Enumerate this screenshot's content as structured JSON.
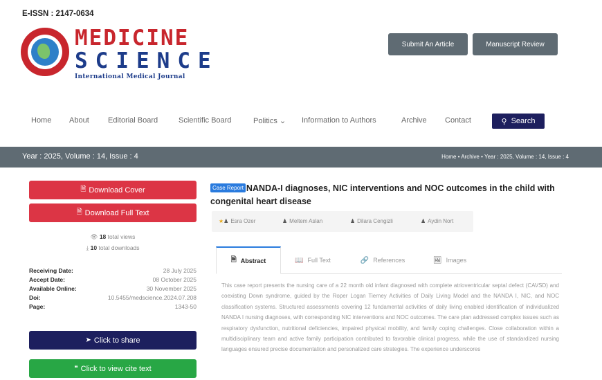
{
  "header": {
    "issn": "E-ISSN : 2147-0634",
    "logo_line1": "MEDICINE",
    "logo_line2": "SCIENCE",
    "logo_line3": "International Medical Journal",
    "submit_label": "Submit An Article",
    "review_label": "Manuscript Review"
  },
  "nav": {
    "items": [
      "Home",
      "About",
      "Editorial Board",
      "Scientific Board",
      "Politics ⌄",
      "Information to Authors",
      "Archive",
      "Contact"
    ],
    "search_label": "Search"
  },
  "issue_bar": {
    "issue": "Year : 2025, Volume : 14, Issue : 4",
    "breadcrumb": "Home • Archive • Year : 2025, Volume : 14, Issue : 4"
  },
  "sidebar": {
    "download_cover": "Download Cover",
    "download_full_text": "Download Full Text",
    "views_count": "18",
    "views_label": "total views",
    "downloads_count": "10",
    "downloads_label": "total downloads",
    "meta": [
      {
        "key": "Receiving Date:",
        "value": "28 July 2025"
      },
      {
        "key": "Accept Date:",
        "value": "08 October 2025"
      },
      {
        "key": "Available Online:",
        "value": "30 November 2025"
      },
      {
        "key": "Doi:",
        "value": "10.5455/medscience.2024.07.208"
      },
      {
        "key": "Page:",
        "value": "1343-50"
      }
    ],
    "share_label": "Click to share",
    "cite_label": "Click to view cite text"
  },
  "article": {
    "badge": "Case Report",
    "title": "NANDA-I diagnoses, NIC interventions and NOC outcomes in the child with congenital heart disease",
    "authors": [
      "Esra Ozer",
      "Meltem Aslan",
      "Dilara Cengizli",
      "Aydin Nort"
    ],
    "tabs": [
      "Abstract",
      "Full Text",
      "References",
      "Images"
    ],
    "abstract": "This case report presents the nursing care of a 22 month old infant diagnosed with complete atrioventricular septal defect (CAVSD) and coexisting Down syndrome, guided by the Roper Logan Tierney Activities of Daily Living Model and the NANDA I, NIC, and NOC classification systems. Structured assessments covering 12 fundamental activities of daily living enabled identification of individualized NANDA I nursing diagnoses, with corresponding NIC interventions and NOC outcomes. The care plan addressed complex issues such as respiratory dysfunction, nutritional deficiencies, impaired physical mobility, and family coping challenges. Close collaboration within a multidisciplinary team and active family participation contributed to favorable clinical progress, while the use of standardized nursing languages ensured precise documentation and personalized care strategies. The experience underscores"
  },
  "colors": {
    "red": "#dc3545",
    "navy": "#1d1f5e",
    "green": "#28a745",
    "gray_bar": "#5f6b73",
    "accent_blue": "#2a7bde"
  }
}
